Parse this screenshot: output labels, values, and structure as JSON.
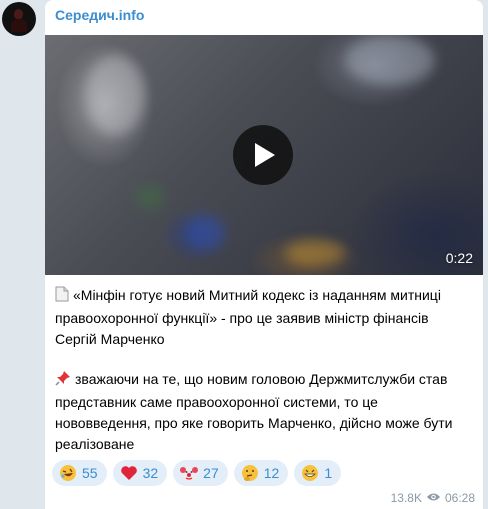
{
  "channel": {
    "name": "Середич.info"
  },
  "video": {
    "duration": "0:22"
  },
  "post": {
    "paragraph1": "«Мінфін готує новий Митний кодекс із наданням митниці правоохоронної функції» - про це заявив міністр фінансів Сергій Марченко",
    "paragraph1_icon": "page-icon",
    "paragraph2": "зважаючи на те, що новим головою Держмитслужби став представник саме правоохоронної системи, то це нововведення, про яке говорить Марченко, дійсно може бути реалізоване",
    "paragraph2_icon": "pushpin-icon"
  },
  "reactions": [
    {
      "emoji": "rofl-emoji",
      "count": "55"
    },
    {
      "emoji": "red-heart-emoji",
      "count": "32"
    },
    {
      "emoji": "clown-emoji",
      "count": "27"
    },
    {
      "emoji": "thinking-emoji",
      "count": "12"
    },
    {
      "emoji": "grin-emoji",
      "count": "1"
    }
  ],
  "meta": {
    "views": "13.8K",
    "time": "06:28"
  },
  "colors": {
    "accent": "#3a8dd0",
    "reaction_bg": "#e3eef8",
    "chat_bg": "#dfe7ec"
  }
}
